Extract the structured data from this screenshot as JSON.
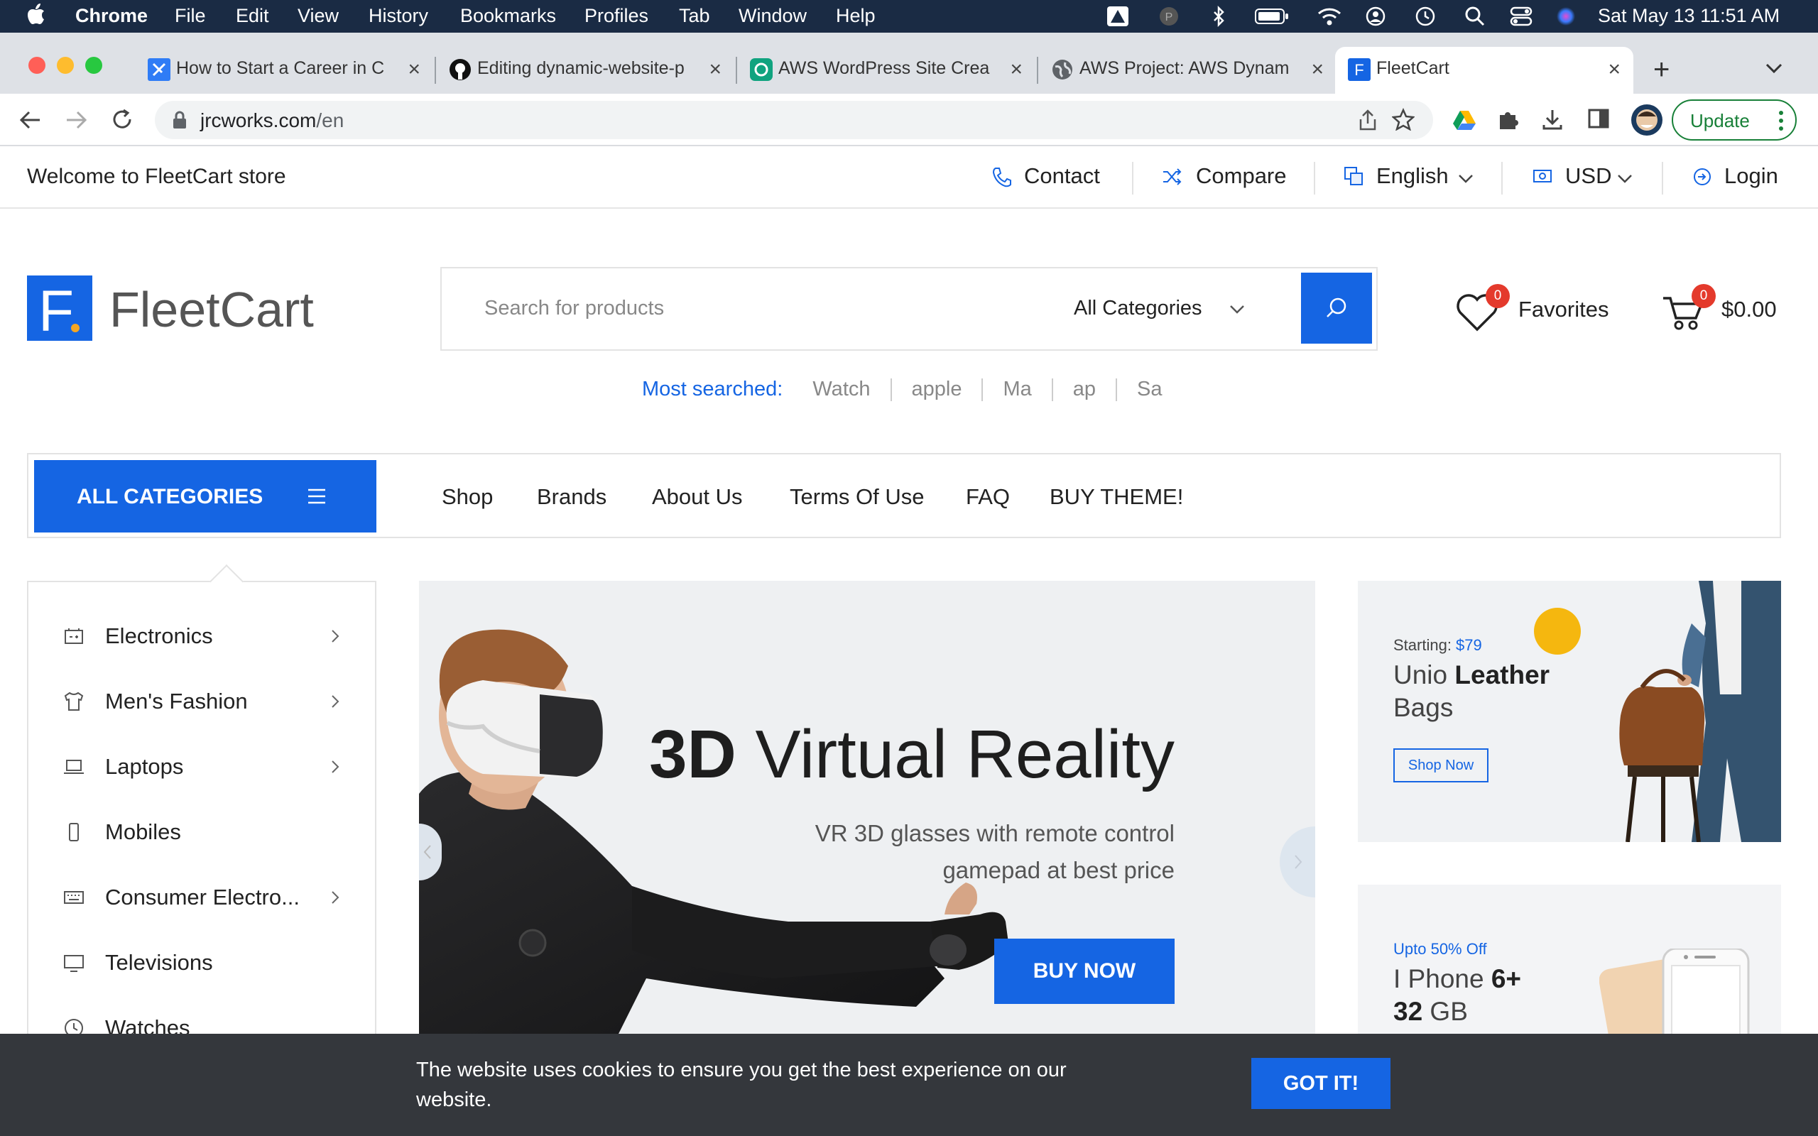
{
  "mac_menubar": {
    "app": "Chrome",
    "menus": [
      "File",
      "Edit",
      "View",
      "History",
      "Bookmarks",
      "Profiles",
      "Tab",
      "Window",
      "Help"
    ],
    "datetime": "Sat May 13  11:51 AM"
  },
  "browser": {
    "tabs": [
      {
        "title": "How to Start a Career in C",
        "icon": "kodekloud-icon"
      },
      {
        "title": "Editing dynamic-website-p",
        "icon": "github-icon"
      },
      {
        "title": "AWS WordPress Site Crea",
        "icon": "chatgpt-icon"
      },
      {
        "title": "AWS Project: AWS Dynam",
        "icon": "globe-icon"
      },
      {
        "title": "FleetCart",
        "icon": "fleetcart-icon",
        "active": true
      }
    ],
    "url_host": "jrcworks.com",
    "url_path": "/en",
    "update_label": "Update"
  },
  "topbar": {
    "welcome": "Welcome to FleetCart store",
    "contact": "Contact",
    "compare": "Compare",
    "language": "English",
    "currency": "USD",
    "login": "Login"
  },
  "header": {
    "logo_letter": "F",
    "logo_text": "FleetCart",
    "search_placeholder": "Search for products",
    "category_select": "All Categories",
    "favorites_label": "Favorites",
    "favorites_count": "0",
    "cart_count": "0",
    "cart_total": "$0.00",
    "most_searched_label": "Most searched:",
    "most_searched": [
      "Watch",
      "apple",
      "Ma",
      "ap",
      "Sa"
    ]
  },
  "nav": {
    "all_categories": "ALL CATEGORIES",
    "links": [
      "Shop",
      "Brands",
      "About Us",
      "Terms Of Use",
      "FAQ",
      "BUY THEME!"
    ]
  },
  "categories": [
    {
      "label": "Electronics",
      "icon": "battery-icon",
      "has_sub": true
    },
    {
      "label": "Men's Fashion",
      "icon": "shirt-icon",
      "has_sub": true
    },
    {
      "label": "Laptops",
      "icon": "laptop-icon",
      "has_sub": true
    },
    {
      "label": "Mobiles",
      "icon": "mobile-icon",
      "has_sub": false
    },
    {
      "label": "Consumer Electro...",
      "icon": "keyboard-icon",
      "has_sub": true
    },
    {
      "label": "Televisions",
      "icon": "tv-icon",
      "has_sub": false
    },
    {
      "label": "Watches",
      "icon": "clock-icon",
      "has_sub": false
    }
  ],
  "hero": {
    "title_bold": "3D",
    "title_rest": " Virtual Reality",
    "subtitle_line1": "VR 3D glasses with remote control",
    "subtitle_line2": "gamepad at best price",
    "cta": "BUY NOW"
  },
  "promo1": {
    "starting_label": "Starting: ",
    "price": "$79",
    "title_light": "Unio ",
    "title_bold": "Leather",
    "title_line2": "Bags",
    "cta": "Shop Now"
  },
  "promo2": {
    "tag": "Upto 50% Off",
    "title_light": "I Phone ",
    "title_bold": "6+",
    "line2_bold": "32",
    "line2_rest": " GB"
  },
  "cookie": {
    "text": "The website uses cookies to ensure you get the best experience on our website.",
    "button": "GOT IT!"
  },
  "colors": {
    "brand_blue": "#1565e3",
    "badge_red": "#e43a2c",
    "cookie_bg": "#34373c"
  }
}
